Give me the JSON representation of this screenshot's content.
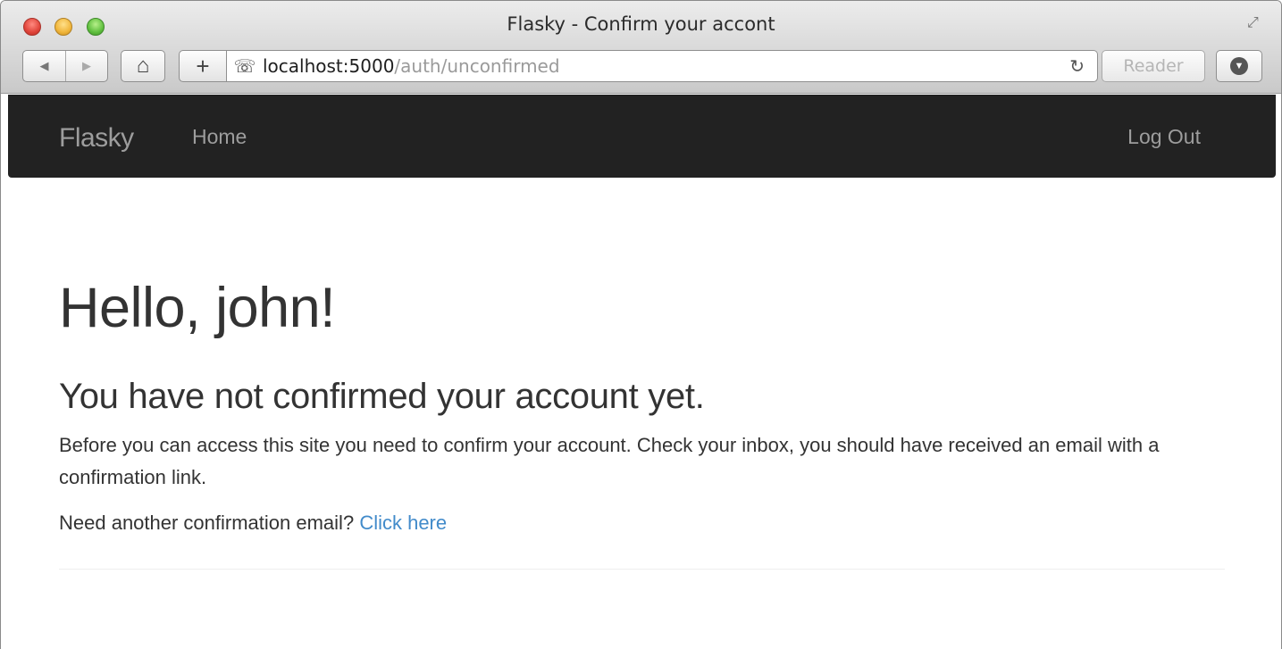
{
  "browser": {
    "title": "Flasky - Confirm your accont",
    "url_host": "localhost:5000",
    "url_path": "/auth/unconfirmed",
    "reader_label": "Reader",
    "back_icon": "◀",
    "forward_icon": "▶",
    "home_icon": "⌂",
    "new_tab_icon": "+",
    "address_icon": "☏",
    "reload_icon": "↻",
    "download_icon": "▼",
    "fullscreen_icon": "⤢"
  },
  "navbar": {
    "brand": "Flasky",
    "home": "Home",
    "logout": "Log Out"
  },
  "content": {
    "greeting": "Hello, john!",
    "subtitle": "You have not confirmed your account yet.",
    "message": "Before you can access this site you need to confirm your account. Check your inbox, you should have received an email with a confirmation link.",
    "resend_prompt": "Need another confirmation email?",
    "resend_link": "Click here"
  },
  "colors": {
    "navbar_bg": "#222222",
    "navbar_text": "#9d9d9d",
    "link": "#428bca",
    "text": "#333333"
  }
}
